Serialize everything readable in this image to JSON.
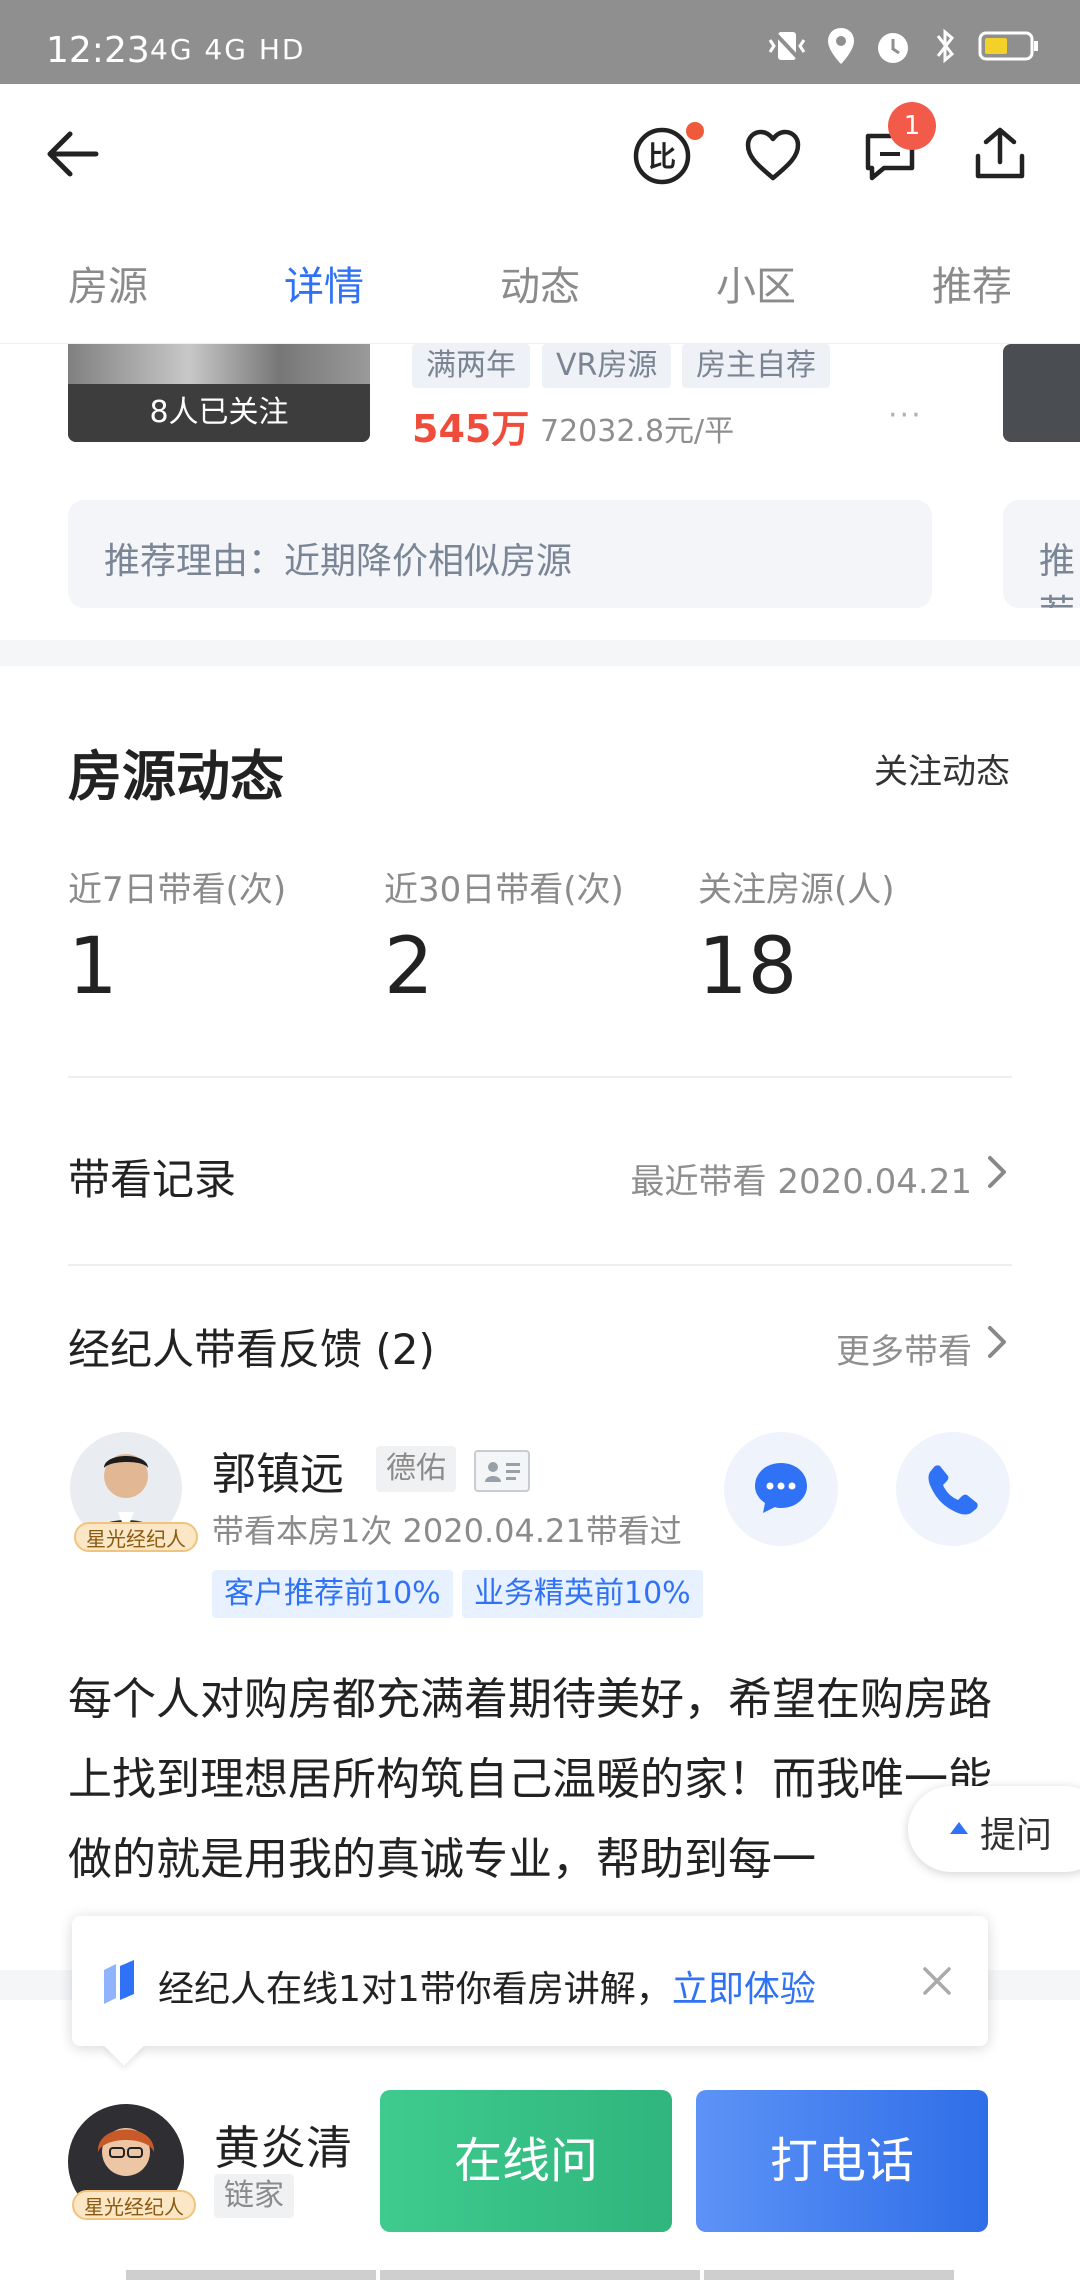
{
  "status_bar": {
    "time": "12:23",
    "network": "4G 4G HD"
  },
  "header": {
    "back_icon": "arrow-left-icon",
    "compare_icon": "compare-icon",
    "favorite_icon": "heart-icon",
    "message_icon": "chat-icon",
    "message_badge": "1",
    "share_icon": "share-icon"
  },
  "tabs": [
    {
      "label": "房源",
      "active": false
    },
    {
      "label": "详情",
      "active": true
    },
    {
      "label": "动态",
      "active": false
    },
    {
      "label": "小区",
      "active": false
    },
    {
      "label": "推荐",
      "active": false
    }
  ],
  "recommend_card": {
    "followers": "8人已关注",
    "tags": [
      "满两年",
      "VR房源",
      "房主自荐"
    ],
    "price": "545万",
    "unit_price": "72032.8元/平",
    "more": "···",
    "reason": "推荐理由：近期降价相似房源",
    "reason_peek": "推荐"
  },
  "dynamics": {
    "title": "房源动态",
    "follow_link": "关注动态",
    "stats": [
      {
        "label": "近7日带看(次)",
        "value": "1"
      },
      {
        "label": "近30日带看(次)",
        "value": "2"
      },
      {
        "label": "关注房源(人)",
        "value": "18"
      }
    ],
    "viewing_record": {
      "title": "带看记录",
      "recent": "最近带看 2020.04.21"
    },
    "feedback": {
      "title": "经纪人带看反馈 (2)",
      "more": "更多带看"
    }
  },
  "agent": {
    "name": "郭镇远",
    "company": "德佑",
    "star_badge": "星光经纪人",
    "desc": "带看本房1次 2020.04.21带看过",
    "tags": [
      "客户推荐前10%",
      "业务精英前10%"
    ],
    "review": "每个人对购房都充满着期待美好，希望在购房路上找到理想居所构筑自己温暖的家！而我唯一能做的就是用我的真诚专业，帮助到每一"
  },
  "ask_button": "提问",
  "toast": {
    "text": "经纪人在线1对1带你看房讲解，",
    "link": "立即体验"
  },
  "bottom_bar": {
    "name": "黄炎清",
    "company": "链家",
    "star_badge": "星光经纪人",
    "online_button": "在线问",
    "call_button": "打电话"
  },
  "colors": {
    "accent": "#3072f6",
    "price": "#f04c3c",
    "online_green": "#2fb57d",
    "call_blue": "#2f6ee8"
  }
}
